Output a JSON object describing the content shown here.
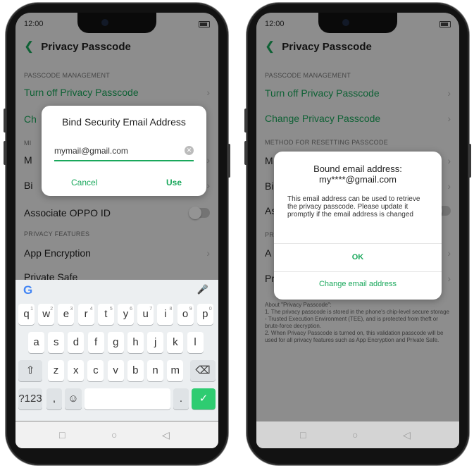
{
  "left": {
    "status_time": "12:00",
    "header_title": "Privacy Passcode",
    "section_passcode_management": "PASSCODE MANAGEMENT",
    "row_turn_off": "Turn off Privacy Passcode",
    "row_change_partial": "Ch",
    "section_method_partial": "MI",
    "row_method_partial": "M",
    "row_bind_partial": "Bi",
    "row_associate": "Associate OPPO ID",
    "section_privacy_features": "PRIVACY FEATURES",
    "row_app_encryption": "App Encryption",
    "row_private_safe": "Private Safe",
    "dialog": {
      "title": "Bind Security Email Address",
      "email_value": "mymail@gmail.com",
      "cancel_label": "Cancel",
      "use_label": "Use"
    },
    "keyboard": {
      "row1": [
        {
          "k": "q",
          "n": "1"
        },
        {
          "k": "w",
          "n": "2"
        },
        {
          "k": "e",
          "n": "3"
        },
        {
          "k": "r",
          "n": "4"
        },
        {
          "k": "t",
          "n": "5"
        },
        {
          "k": "y",
          "n": "6"
        },
        {
          "k": "u",
          "n": "7"
        },
        {
          "k": "i",
          "n": "8"
        },
        {
          "k": "o",
          "n": "9"
        },
        {
          "k": "p",
          "n": "0"
        }
      ],
      "row2": [
        "a",
        "s",
        "d",
        "f",
        "g",
        "h",
        "j",
        "k",
        "l"
      ],
      "row3": [
        "z",
        "x",
        "c",
        "v",
        "b",
        "n",
        "m"
      ],
      "symbols_label": "?123",
      "comma_label": ",",
      "period_label": "."
    }
  },
  "right": {
    "status_time": "12:00",
    "header_title": "Privacy Passcode",
    "section_passcode_management": "PASSCODE MANAGEMENT",
    "row_turn_off": "Turn off Privacy Passcode",
    "row_change": "Change Privacy Passcode",
    "section_method": "METHOD FOR RESETTING PASSCODE",
    "row_m_partial": "M",
    "row_bi_partial": "Bi",
    "row_as_partial": "As",
    "section_pr_partial": "PR",
    "row_ap_partial": "A",
    "row_pr_partial": "Pr",
    "about_note": "About \"Privacy Passcode\":\n1. The privacy passcode is stored in the phone's chip-level secure storage - Trusted Execution Environment (TEE), and is protected from theft or brute-force decryption.\n2. When Privacy Passcode is turned on, this validation passcode will be used for all privacy features such as App Encryption and Private Safe.",
    "dialog": {
      "title_line1": "Bound email address:",
      "title_line2": "my****@gmail.com",
      "body": "This email address can be used to retrieve the privacy passcode. Please update it promptly if the email address is changed",
      "ok_label": "OK",
      "change_label": "Change email address"
    }
  }
}
